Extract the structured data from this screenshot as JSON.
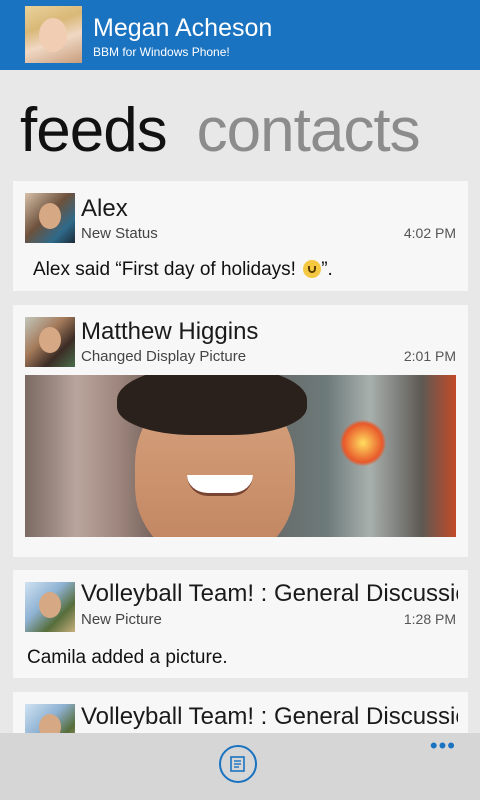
{
  "header": {
    "name": "Megan Acheson",
    "subtitle": "BBM for Windows Phone!"
  },
  "pivot": {
    "active": "feeds",
    "inactive": "contacts"
  },
  "feed": [
    {
      "title": "Alex",
      "type": "New Status",
      "time": "4:02 PM",
      "body_prefix": "Alex said “First day of holidays! ",
      "body_suffix": "”."
    },
    {
      "title": "Matthew Higgins",
      "type": "Changed Display Picture",
      "time": "2:01 PM"
    },
    {
      "title": "Volleyball Team! : General Discussion",
      "type": "New Picture",
      "time": "1:28 PM",
      "body": "Camila added a picture."
    },
    {
      "title": "Volleyball Team! : General Discussion"
    }
  ],
  "appbar": {
    "more": "•••"
  },
  "colors": {
    "accent": "#1a73c1"
  }
}
